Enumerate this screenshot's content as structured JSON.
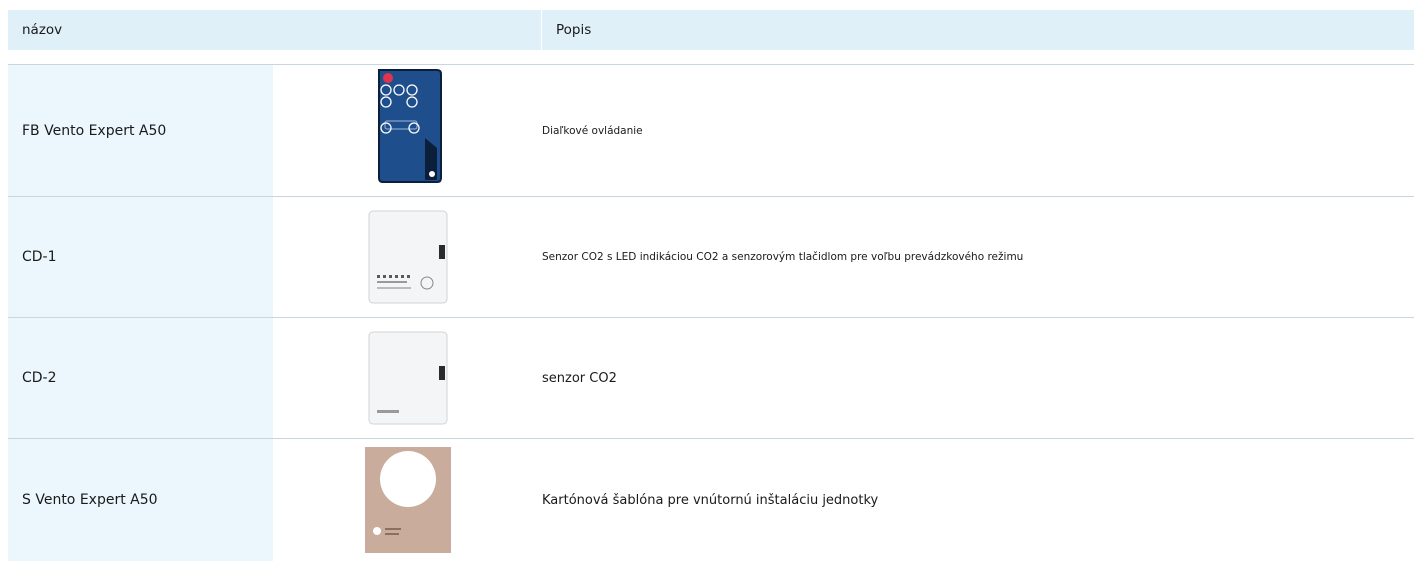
{
  "header": {
    "name_label": "názov",
    "desc_label": "Popis"
  },
  "rows": [
    {
      "name": "FB Vento Expert A50",
      "desc": "Diaľkové ovládanie",
      "image": "remote-control-icon"
    },
    {
      "name": "CD-1",
      "desc": "Senzor CO2 s LED indikáciou CO2 a senzorovým tlačidlom pre voľbu prevádzkového režimu",
      "image": "co2-sensor-led-icon"
    },
    {
      "name": "CD-2",
      "desc": "senzor CO2",
      "image": "co2-sensor-icon"
    },
    {
      "name": "S Vento Expert A50",
      "desc": "Kartónová šablóna pre vnútornú inštaláciu jednotky",
      "image": "cardboard-template-icon"
    }
  ],
  "colors": {
    "header_bg": "#dff0f9",
    "name_cell_bg": "#ebf7fd",
    "row_border": "#c9d6dd",
    "remote_body": "#1f4e8c",
    "template_card": "#c9ac9b"
  }
}
